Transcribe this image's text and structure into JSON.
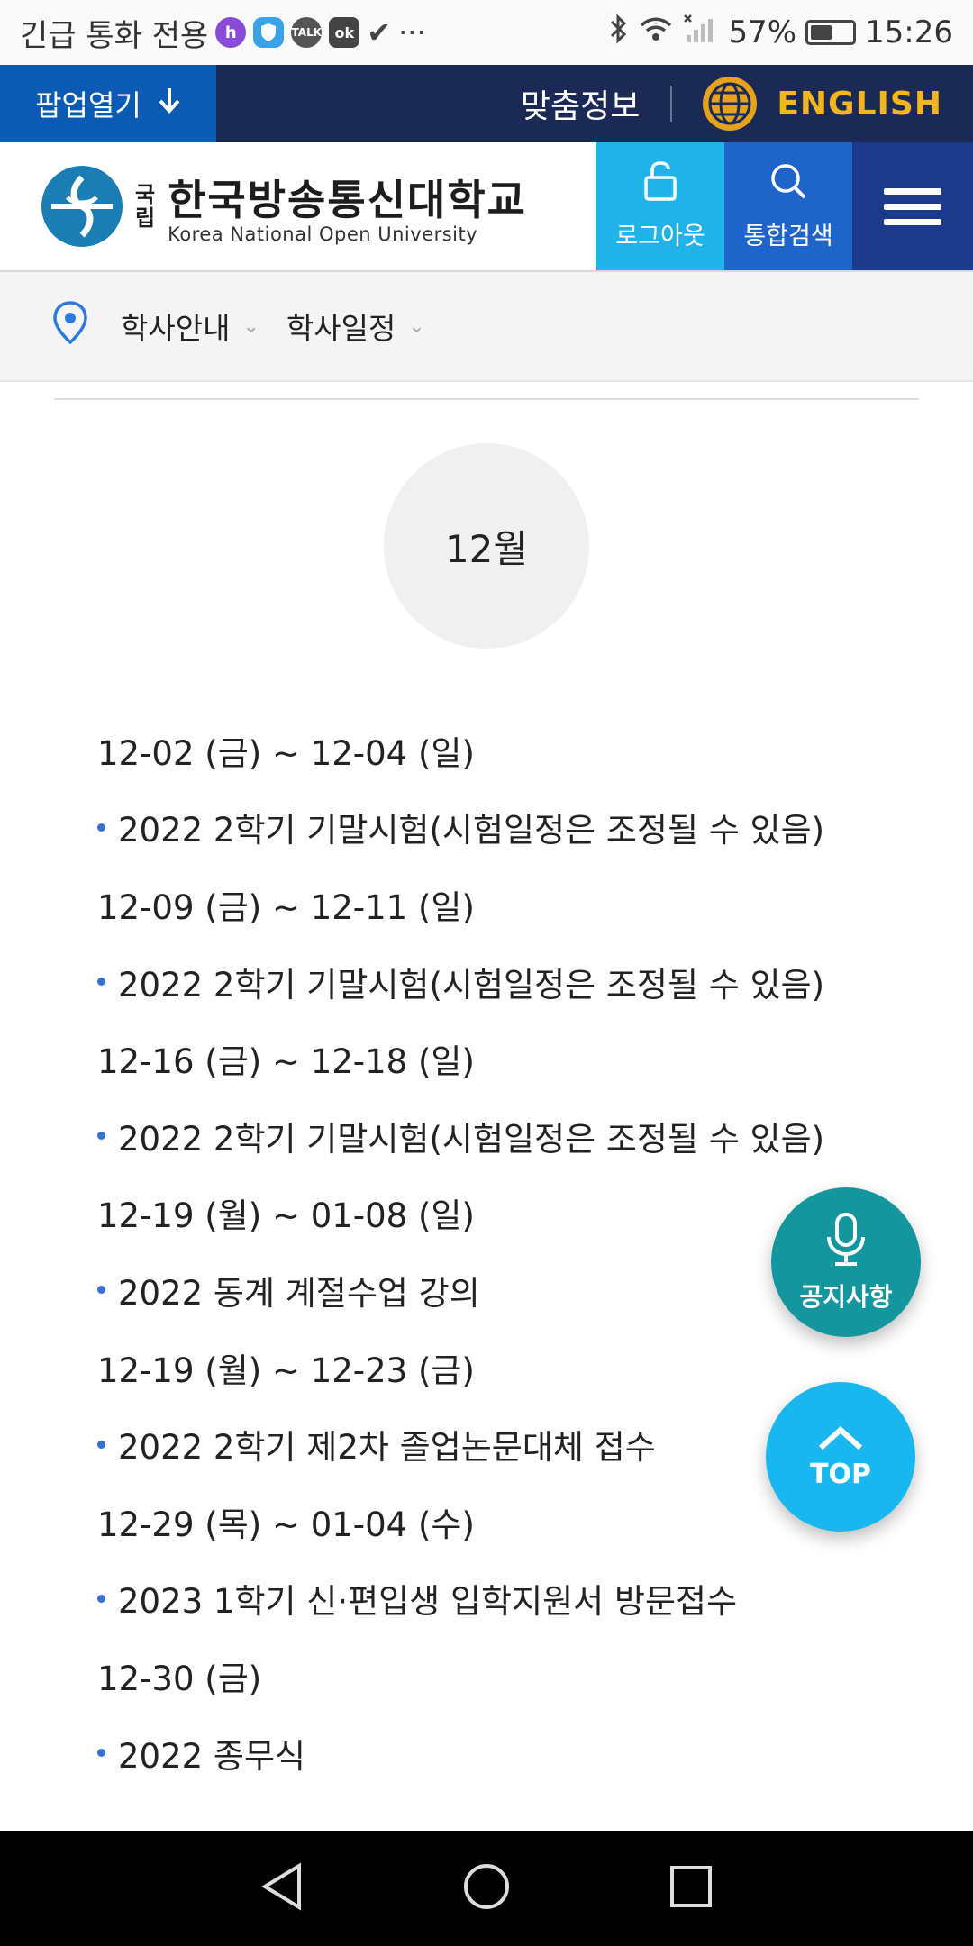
{
  "statusbar": {
    "carrier": "긴급 통화 전용",
    "icon_h": "h",
    "icon_talk": "TALK",
    "icon_ok": "ok",
    "more": "···",
    "battery": "57%",
    "battery_level": 0.57,
    "time": "15:26"
  },
  "topbar": {
    "popup_label": "팝업열기",
    "custom_label": "맞춤정보",
    "english_label": "ENGLISH"
  },
  "header": {
    "logo_small_1": "국",
    "logo_small_2": "립",
    "logo_main": "한국방송통신대학교",
    "logo_sub": "Korea National Open University",
    "logout_label": "로그아웃",
    "search_label": "통합검색"
  },
  "breadcrumb": {
    "items": [
      "학사안내",
      "학사일정"
    ]
  },
  "calendar": {
    "month": "12월",
    "entries": [
      {
        "date": "12-02 (금) ~ 12-04 (일)",
        "event": "2022 2학기 기말시험(시험일정은 조정될 수 있음)"
      },
      {
        "date": "12-09 (금) ~ 12-11 (일)",
        "event": "2022 2학기 기말시험(시험일정은 조정될 수 있음)"
      },
      {
        "date": "12-16 (금) ~ 12-18 (일)",
        "event": "2022 2학기 기말시험(시험일정은 조정될 수 있음)"
      },
      {
        "date": "12-19 (월) ~ 01-08 (일)",
        "event": "2022 동계 계절수업 강의"
      },
      {
        "date": "12-19 (월) ~ 12-23 (금)",
        "event": "2022 2학기 제2차 졸업논문대체 접수"
      },
      {
        "date": "12-29 (목) ~ 01-04 (수)",
        "event": "2023 1학기 신·편입생 입학지원서 방문접수"
      },
      {
        "date": "12-30 (금)",
        "event": "2022 종무식"
      }
    ]
  },
  "floating": {
    "notice_label": "공지사항",
    "top_label": "TOP"
  },
  "colors": {
    "topbar": "#1b2a55",
    "popup": "#0b5bb5",
    "english": "#f2b420",
    "logout": "#1fb3ea",
    "search": "#1f64c8",
    "menu": "#1b3a8c",
    "notice_fab": "#14969f",
    "top_fab": "#18b7ef"
  }
}
